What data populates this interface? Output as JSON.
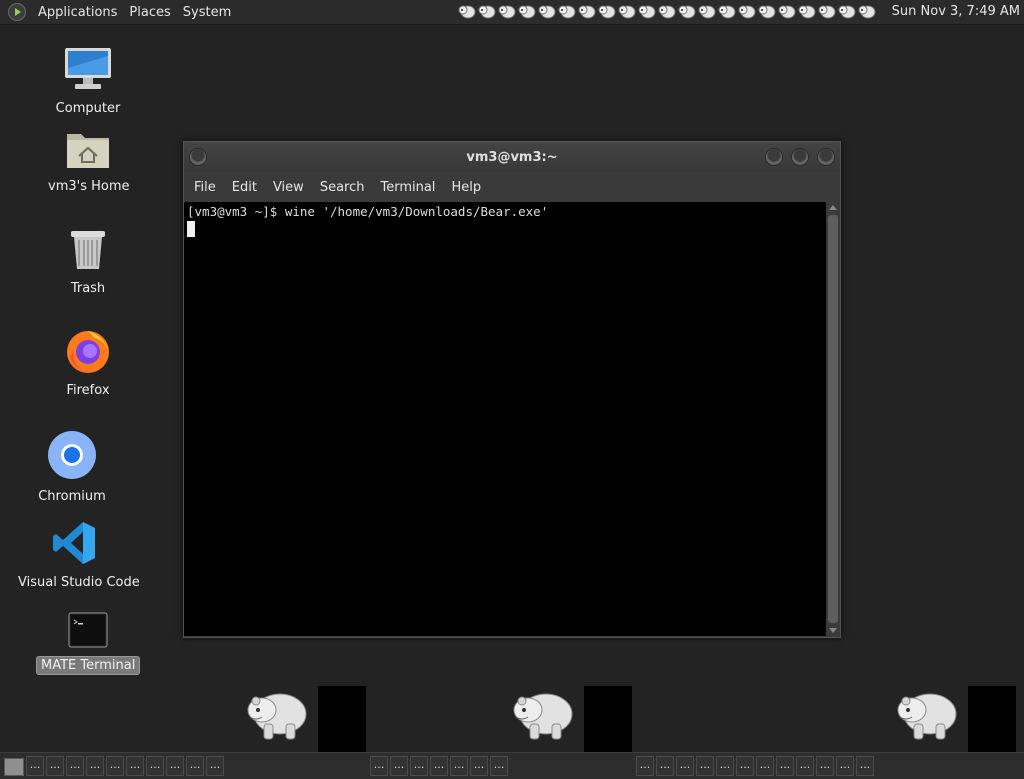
{
  "top_panel": {
    "menus": [
      "Applications",
      "Places",
      "System"
    ],
    "clock": "Sun Nov 3,  7:49 AM",
    "tray_icon_count": 21,
    "tray_icon_name": "wine-bear-tray-icon"
  },
  "desktop": {
    "icons": [
      {
        "label": "Computer",
        "icon": "computer-icon"
      },
      {
        "label": "vm3's Home",
        "icon": "home-folder-icon"
      },
      {
        "label": "Trash",
        "icon": "trash-icon"
      },
      {
        "label": "Firefox",
        "icon": "firefox-icon"
      },
      {
        "label": "Chromium",
        "icon": "chromium-icon"
      },
      {
        "label": "Visual Studio Code",
        "icon": "vscode-icon"
      },
      {
        "label": "MATE Terminal",
        "icon": "terminal-icon"
      }
    ]
  },
  "terminal": {
    "title": "vm3@vm3:~",
    "menus": [
      "File",
      "Edit",
      "View",
      "Search",
      "Terminal",
      "Help"
    ],
    "line1": "[vm3@vm3 ~]$ wine '/home/vm3/Downloads/Bear.exe'"
  },
  "bottom_panel": {
    "task_label": "...",
    "task_count": 44
  },
  "colors": {
    "desktop_bg": "#232323",
    "panel_bg": "#2b2b2b",
    "terminal_bg": "#000000",
    "selection": "#7a7a7a"
  }
}
